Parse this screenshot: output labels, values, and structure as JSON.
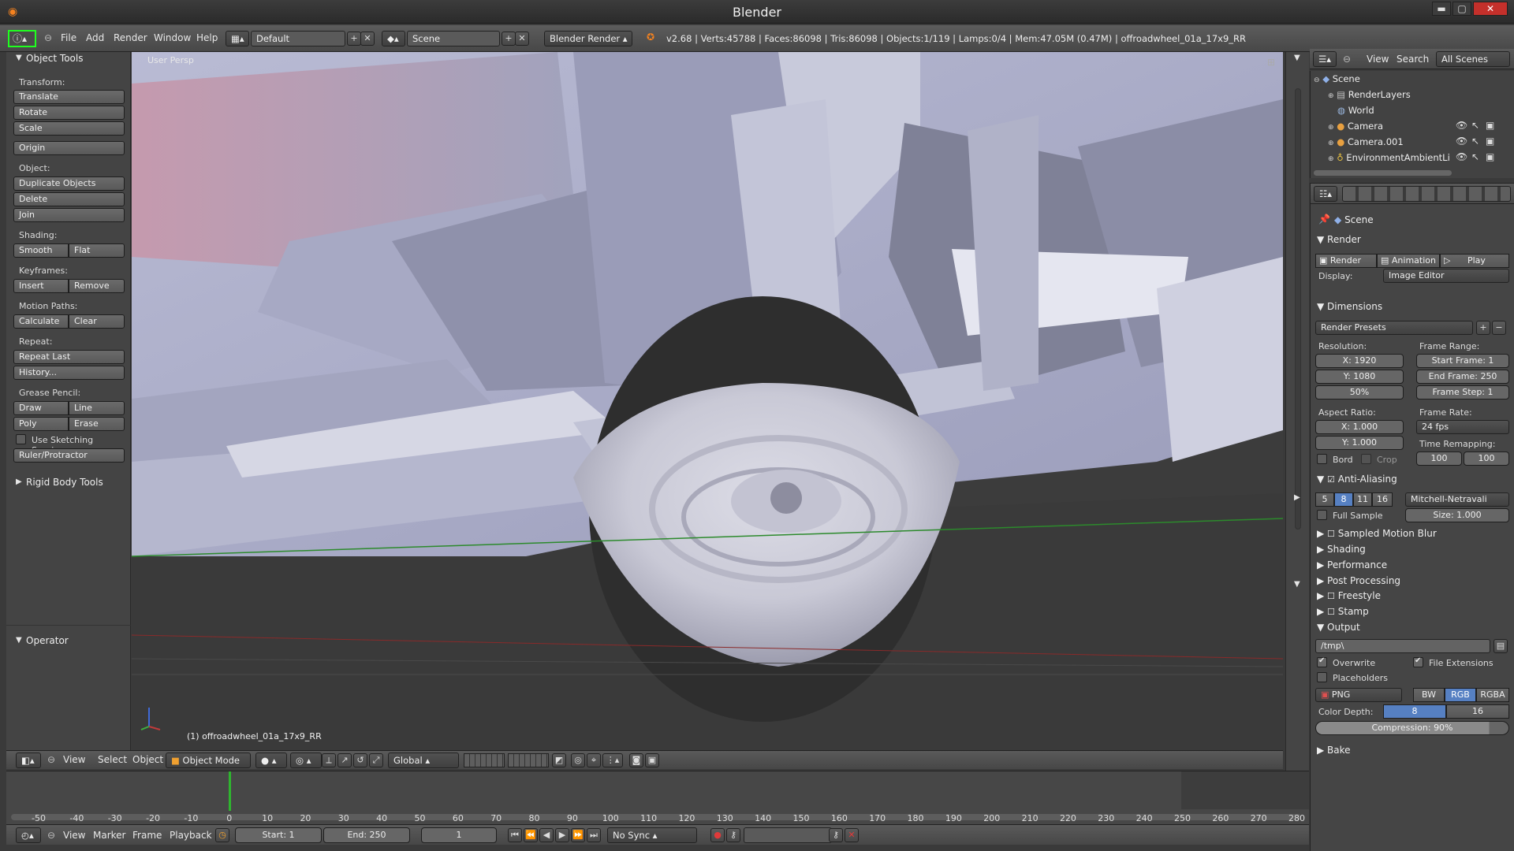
{
  "window": {
    "title": "Blender",
    "logo": "blender-logo-icon",
    "minimize": "▬",
    "maximize": "▢",
    "close": "✕"
  },
  "info": {
    "menus": [
      "File",
      "Add",
      "Render",
      "Window",
      "Help"
    ],
    "layout": "Default",
    "scene": "Scene",
    "engine": "Blender Render",
    "stats": "v2.68 | Verts:45788 | Faces:86098 | Tris:86098 | Objects:1/119 | Lamps:0/4 | Mem:47.05M (0.47M) | offroadwheel_01a_17x9_RR"
  },
  "tools": {
    "title": "Object Tools",
    "transform": "Transform:",
    "translate": "Translate",
    "rotate": "Rotate",
    "scale": "Scale",
    "origin": "Origin",
    "object": "Object:",
    "duplicate": "Duplicate Objects",
    "delete": "Delete",
    "join": "Join",
    "shading": "Shading:",
    "smooth": "Smooth",
    "flat": "Flat",
    "keyframes": "Keyframes:",
    "insert": "Insert",
    "remove": "Remove",
    "motion": "Motion Paths:",
    "calculate": "Calculate",
    "clear": "Clear",
    "repeat": "Repeat:",
    "repeat_last": "Repeat Last",
    "history": "History...",
    "grease": "Grease Pencil:",
    "draw": "Draw",
    "line": "Line",
    "poly": "Poly",
    "erase": "Erase",
    "sketch": "Use Sketching Sessions",
    "ruler": "Ruler/Protractor",
    "rigid": "Rigid Body Tools",
    "operator": "Operator"
  },
  "viewport": {
    "persp": "User Persp",
    "object_label": "(1) offroadwheel_01a_17x9_RR",
    "header": {
      "view": "View",
      "select": "Select",
      "object": "Object",
      "mode": "Object Mode",
      "orientation": "Global"
    }
  },
  "timeline": {
    "ticks": [
      "-50",
      "-40",
      "-30",
      "-20",
      "-10",
      "0",
      "10",
      "20",
      "30",
      "40",
      "50",
      "60",
      "70",
      "80",
      "90",
      "100",
      "110",
      "120",
      "130",
      "140",
      "150",
      "160",
      "170",
      "180",
      "190",
      "200",
      "210",
      "220",
      "230",
      "240",
      "250",
      "260",
      "270",
      "280"
    ],
    "view": "View",
    "marker": "Marker",
    "frame": "Frame",
    "playback": "Playback",
    "start": "Start: 1",
    "end": "End: 250",
    "current": "1",
    "sync": "No Sync"
  },
  "outliner": {
    "view": "View",
    "search": "Search",
    "filter": "All Scenes",
    "items": [
      "Scene",
      "RenderLayers",
      "World",
      "Camera",
      "Camera.001",
      "EnvironmentAmbientLi"
    ]
  },
  "props": {
    "context": "Scene",
    "render": "Render",
    "render_btn": "Render",
    "animation_btn": "Animation",
    "play_btn": "Play",
    "display_label": "Display:",
    "display": "Image Editor",
    "dimensions": "Dimensions",
    "presets": "Render Presets",
    "resolution": "Resolution:",
    "res_x": "X: 1920",
    "res_y": "Y: 1080",
    "res_pct": "50%",
    "frame_range": "Frame Range:",
    "start_frame": "Start Frame: 1",
    "end_frame": "End Frame: 250",
    "frame_step": "Frame Step: 1",
    "aspect": "Aspect Ratio:",
    "asp_x": "X: 1.000",
    "asp_y": "Y: 1.000",
    "frame_rate": "Frame Rate:",
    "fps": "24 fps",
    "remap": "Time Remapping:",
    "remap_old": "100",
    "remap_new": "100",
    "bord": "Bord",
    "crop": "Crop",
    "aa": "Anti-Aliasing",
    "aa_samples": [
      "5",
      "8",
      "11",
      "16"
    ],
    "aa_filter": "Mitchell-Netravali",
    "full_sample": "Full Sample",
    "size": "Size: 1.000",
    "motion_blur": "Sampled Motion Blur",
    "shading": "Shading",
    "performance": "Performance",
    "post": "Post Processing",
    "freestyle": "Freestyle",
    "stamp": "Stamp",
    "output": "Output",
    "path": "/tmp\\",
    "overwrite": "Overwrite",
    "file_ext": "File Extensions",
    "placeholders": "Placeholders",
    "format": "PNG",
    "bw": "BW",
    "rgb": "RGB",
    "rgba": "RGBA",
    "color_depth": "Color Depth:",
    "depth8": "8",
    "depth16": "16",
    "compression": "Compression: 90%",
    "bake": "Bake"
  },
  "colors": {
    "accent": "#5680c2",
    "active_frame": "#2fb52f"
  }
}
